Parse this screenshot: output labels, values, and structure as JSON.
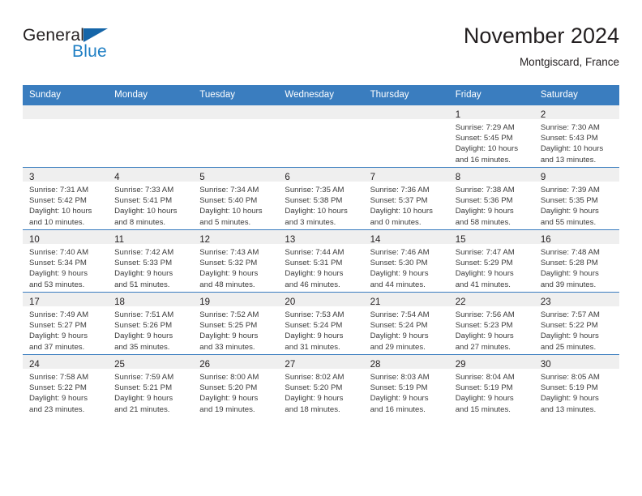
{
  "brand": {
    "name_top": "General",
    "name_bottom": "Blue",
    "triangle_color": "#1565a8",
    "blue_color": "#1f7fc4"
  },
  "header": {
    "title": "November 2024",
    "subtitle": "Montgiscard, France"
  },
  "theme": {
    "header_bar_color": "#3a7dbf",
    "daynum_band_color": "#efefef",
    "row_border_color": "#3a7dbf",
    "text_color": "#231f20"
  },
  "calendar": {
    "weekday_headers": [
      "Sunday",
      "Monday",
      "Tuesday",
      "Wednesday",
      "Thursday",
      "Friday",
      "Saturday"
    ],
    "weeks": [
      [
        {
          "day": "",
          "empty": true
        },
        {
          "day": "",
          "empty": true
        },
        {
          "day": "",
          "empty": true
        },
        {
          "day": "",
          "empty": true
        },
        {
          "day": "",
          "empty": true
        },
        {
          "day": "1",
          "sunrise": "Sunrise: 7:29 AM",
          "sunset": "Sunset: 5:45 PM",
          "daylight_line1": "Daylight: 10 hours",
          "daylight_line2": "and 16 minutes."
        },
        {
          "day": "2",
          "sunrise": "Sunrise: 7:30 AM",
          "sunset": "Sunset: 5:43 PM",
          "daylight_line1": "Daylight: 10 hours",
          "daylight_line2": "and 13 minutes."
        }
      ],
      [
        {
          "day": "3",
          "sunrise": "Sunrise: 7:31 AM",
          "sunset": "Sunset: 5:42 PM",
          "daylight_line1": "Daylight: 10 hours",
          "daylight_line2": "and 10 minutes."
        },
        {
          "day": "4",
          "sunrise": "Sunrise: 7:33 AM",
          "sunset": "Sunset: 5:41 PM",
          "daylight_line1": "Daylight: 10 hours",
          "daylight_line2": "and 8 minutes."
        },
        {
          "day": "5",
          "sunrise": "Sunrise: 7:34 AM",
          "sunset": "Sunset: 5:40 PM",
          "daylight_line1": "Daylight: 10 hours",
          "daylight_line2": "and 5 minutes."
        },
        {
          "day": "6",
          "sunrise": "Sunrise: 7:35 AM",
          "sunset": "Sunset: 5:38 PM",
          "daylight_line1": "Daylight: 10 hours",
          "daylight_line2": "and 3 minutes."
        },
        {
          "day": "7",
          "sunrise": "Sunrise: 7:36 AM",
          "sunset": "Sunset: 5:37 PM",
          "daylight_line1": "Daylight: 10 hours",
          "daylight_line2": "and 0 minutes."
        },
        {
          "day": "8",
          "sunrise": "Sunrise: 7:38 AM",
          "sunset": "Sunset: 5:36 PM",
          "daylight_line1": "Daylight: 9 hours",
          "daylight_line2": "and 58 minutes."
        },
        {
          "day": "9",
          "sunrise": "Sunrise: 7:39 AM",
          "sunset": "Sunset: 5:35 PM",
          "daylight_line1": "Daylight: 9 hours",
          "daylight_line2": "and 55 minutes."
        }
      ],
      [
        {
          "day": "10",
          "sunrise": "Sunrise: 7:40 AM",
          "sunset": "Sunset: 5:34 PM",
          "daylight_line1": "Daylight: 9 hours",
          "daylight_line2": "and 53 minutes."
        },
        {
          "day": "11",
          "sunrise": "Sunrise: 7:42 AM",
          "sunset": "Sunset: 5:33 PM",
          "daylight_line1": "Daylight: 9 hours",
          "daylight_line2": "and 51 minutes."
        },
        {
          "day": "12",
          "sunrise": "Sunrise: 7:43 AM",
          "sunset": "Sunset: 5:32 PM",
          "daylight_line1": "Daylight: 9 hours",
          "daylight_line2": "and 48 minutes."
        },
        {
          "day": "13",
          "sunrise": "Sunrise: 7:44 AM",
          "sunset": "Sunset: 5:31 PM",
          "daylight_line1": "Daylight: 9 hours",
          "daylight_line2": "and 46 minutes."
        },
        {
          "day": "14",
          "sunrise": "Sunrise: 7:46 AM",
          "sunset": "Sunset: 5:30 PM",
          "daylight_line1": "Daylight: 9 hours",
          "daylight_line2": "and 44 minutes."
        },
        {
          "day": "15",
          "sunrise": "Sunrise: 7:47 AM",
          "sunset": "Sunset: 5:29 PM",
          "daylight_line1": "Daylight: 9 hours",
          "daylight_line2": "and 41 minutes."
        },
        {
          "day": "16",
          "sunrise": "Sunrise: 7:48 AM",
          "sunset": "Sunset: 5:28 PM",
          "daylight_line1": "Daylight: 9 hours",
          "daylight_line2": "and 39 minutes."
        }
      ],
      [
        {
          "day": "17",
          "sunrise": "Sunrise: 7:49 AM",
          "sunset": "Sunset: 5:27 PM",
          "daylight_line1": "Daylight: 9 hours",
          "daylight_line2": "and 37 minutes."
        },
        {
          "day": "18",
          "sunrise": "Sunrise: 7:51 AM",
          "sunset": "Sunset: 5:26 PM",
          "daylight_line1": "Daylight: 9 hours",
          "daylight_line2": "and 35 minutes."
        },
        {
          "day": "19",
          "sunrise": "Sunrise: 7:52 AM",
          "sunset": "Sunset: 5:25 PM",
          "daylight_line1": "Daylight: 9 hours",
          "daylight_line2": "and 33 minutes."
        },
        {
          "day": "20",
          "sunrise": "Sunrise: 7:53 AM",
          "sunset": "Sunset: 5:24 PM",
          "daylight_line1": "Daylight: 9 hours",
          "daylight_line2": "and 31 minutes."
        },
        {
          "day": "21",
          "sunrise": "Sunrise: 7:54 AM",
          "sunset": "Sunset: 5:24 PM",
          "daylight_line1": "Daylight: 9 hours",
          "daylight_line2": "and 29 minutes."
        },
        {
          "day": "22",
          "sunrise": "Sunrise: 7:56 AM",
          "sunset": "Sunset: 5:23 PM",
          "daylight_line1": "Daylight: 9 hours",
          "daylight_line2": "and 27 minutes."
        },
        {
          "day": "23",
          "sunrise": "Sunrise: 7:57 AM",
          "sunset": "Sunset: 5:22 PM",
          "daylight_line1": "Daylight: 9 hours",
          "daylight_line2": "and 25 minutes."
        }
      ],
      [
        {
          "day": "24",
          "sunrise": "Sunrise: 7:58 AM",
          "sunset": "Sunset: 5:22 PM",
          "daylight_line1": "Daylight: 9 hours",
          "daylight_line2": "and 23 minutes."
        },
        {
          "day": "25",
          "sunrise": "Sunrise: 7:59 AM",
          "sunset": "Sunset: 5:21 PM",
          "daylight_line1": "Daylight: 9 hours",
          "daylight_line2": "and 21 minutes."
        },
        {
          "day": "26",
          "sunrise": "Sunrise: 8:00 AM",
          "sunset": "Sunset: 5:20 PM",
          "daylight_line1": "Daylight: 9 hours",
          "daylight_line2": "and 19 minutes."
        },
        {
          "day": "27",
          "sunrise": "Sunrise: 8:02 AM",
          "sunset": "Sunset: 5:20 PM",
          "daylight_line1": "Daylight: 9 hours",
          "daylight_line2": "and 18 minutes."
        },
        {
          "day": "28",
          "sunrise": "Sunrise: 8:03 AM",
          "sunset": "Sunset: 5:19 PM",
          "daylight_line1": "Daylight: 9 hours",
          "daylight_line2": "and 16 minutes."
        },
        {
          "day": "29",
          "sunrise": "Sunrise: 8:04 AM",
          "sunset": "Sunset: 5:19 PM",
          "daylight_line1": "Daylight: 9 hours",
          "daylight_line2": "and 15 minutes."
        },
        {
          "day": "30",
          "sunrise": "Sunrise: 8:05 AM",
          "sunset": "Sunset: 5:19 PM",
          "daylight_line1": "Daylight: 9 hours",
          "daylight_line2": "and 13 minutes."
        }
      ]
    ]
  }
}
